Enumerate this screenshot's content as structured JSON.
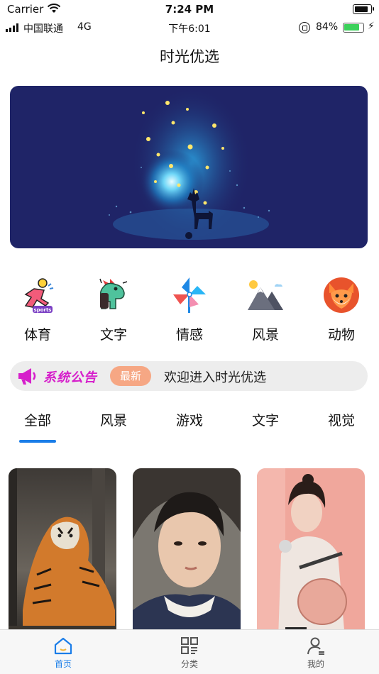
{
  "status_bar": {
    "carrier": "Carrier",
    "time": "7:24 PM",
    "carrier2": "中国联通",
    "network": "4G",
    "time2": "下午6:01",
    "battery_pct": "84%",
    "battery_level": 0.84
  },
  "header": {
    "title": "时光优选"
  },
  "categories": [
    {
      "label": "体育",
      "icon": "sports-icon"
    },
    {
      "label": "文字",
      "icon": "dinosaur-icon"
    },
    {
      "label": "情感",
      "icon": "pinwheel-icon"
    },
    {
      "label": "风景",
      "icon": "mountain-icon"
    },
    {
      "label": "动物",
      "icon": "fox-icon"
    }
  ],
  "notice": {
    "title": "系统公告",
    "badge": "最新",
    "text": "欢迎进入时光优选"
  },
  "tabs": [
    "全部",
    "风景",
    "游戏",
    "文字",
    "视觉"
  ],
  "active_tab": 0,
  "tab_bar": [
    {
      "label": "首页",
      "icon": "home-icon",
      "active": true
    },
    {
      "label": "分类",
      "icon": "grid-icon",
      "active": false
    },
    {
      "label": "我的",
      "icon": "profile-icon",
      "active": false
    }
  ],
  "colors": {
    "accent": "#1a7de8",
    "notice_title": "#d61fcb",
    "badge": "#f6a784",
    "banner_bg": "#1f2467"
  }
}
